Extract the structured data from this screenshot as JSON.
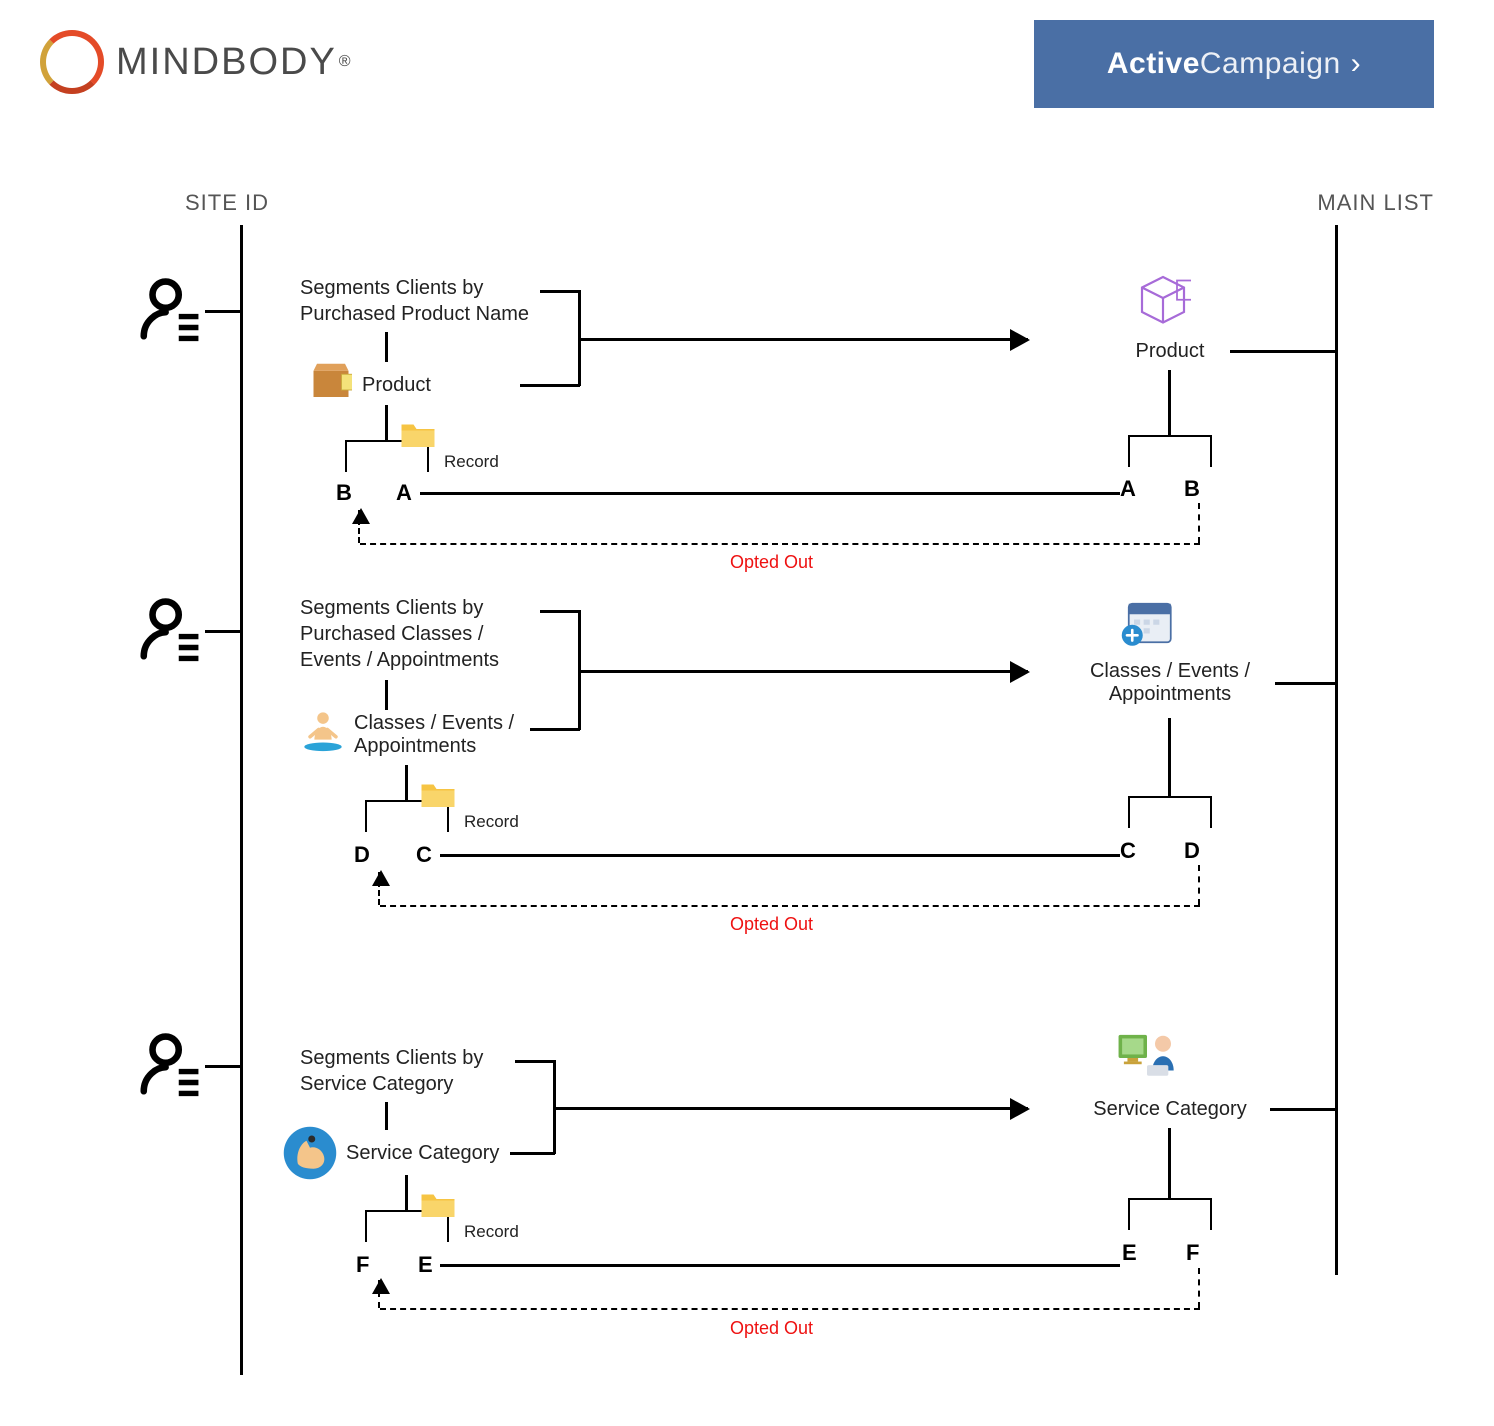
{
  "brands": {
    "mindbody": "MINDBODY",
    "activecampaign_bold": "Active",
    "activecampaign_thin": "Campaign"
  },
  "columns": {
    "left": "SITE ID",
    "right": "MAIN LIST"
  },
  "opted_out": "Opted Out",
  "record": "Record",
  "sections": [
    {
      "segment_label": "Segments Clients by\nPurchased Product Name",
      "left_node": "Product",
      "right_node": "Product",
      "left_tag_a": "B",
      "left_tag_b": "A",
      "right_tag_a": "A",
      "right_tag_b": "B"
    },
    {
      "segment_label": "Segments Clients by\nPurchased Classes /\nEvents / Appointments",
      "left_node": "Classes / Events /\nAppointments",
      "right_node": "Classes / Events /\nAppointments",
      "left_tag_a": "D",
      "left_tag_b": "C",
      "right_tag_a": "C",
      "right_tag_b": "D"
    },
    {
      "segment_label": "Segments Clients by\nService Category",
      "left_node": "Service Category",
      "right_node": "Service Category",
      "left_tag_a": "F",
      "left_tag_b": "E",
      "right_tag_a": "E",
      "right_tag_b": "F"
    }
  ]
}
